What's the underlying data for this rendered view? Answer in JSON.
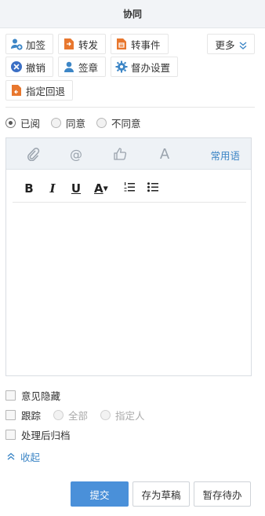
{
  "header": {
    "title": "协同"
  },
  "actions": {
    "add_sign": "加签",
    "forward": "转发",
    "to_event": "转事件",
    "more": "更多",
    "revoke": "撤销",
    "sign_seal": "签章",
    "proxy_setting": "督办设置",
    "assign_return": "指定回退"
  },
  "opinion": {
    "options": [
      "已阅",
      "同意",
      "不同意"
    ],
    "selected": "已阅"
  },
  "editor": {
    "common_phrases": "常用语",
    "at_symbol": "@",
    "font_letter": "A",
    "bold": "B",
    "italic": "I",
    "underline": "U",
    "font_color": "A"
  },
  "options": {
    "hide_opinion": "意见隐藏",
    "track": "跟踪",
    "track_all": "全部",
    "track_specified": "指定人",
    "archive_after": "处理后归档",
    "collapse": "收起"
  },
  "footer": {
    "submit": "提交",
    "save_draft": "存为草稿",
    "hold_pending": "暂存待办"
  },
  "colors": {
    "accent": "#4a90d9",
    "link": "#3d86c6",
    "icon_orange": "#e8772e",
    "icon_blue": "#3d86c6"
  }
}
